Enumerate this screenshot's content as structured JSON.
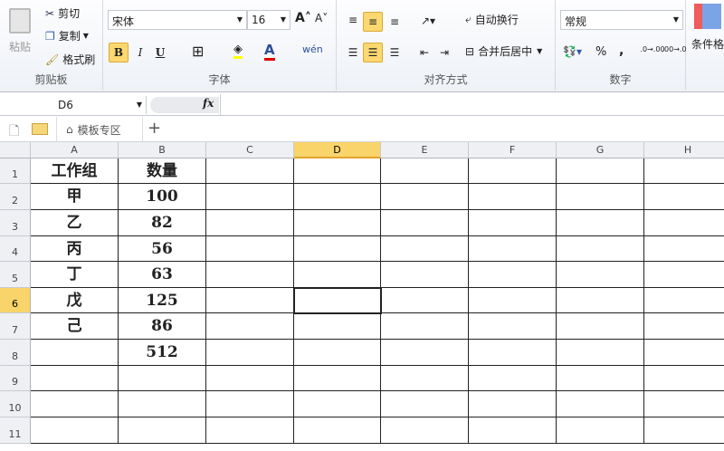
{
  "ribbon": {
    "clipboard": {
      "label": "剪贴板",
      "paste": "粘贴",
      "cut": "剪切",
      "copy": "复制",
      "format_painter": "格式刷"
    },
    "font": {
      "label": "字体",
      "font_name": "宋体",
      "font_size": "16",
      "bold": "B",
      "italic": "I",
      "underline": "U",
      "phonetic": "wén"
    },
    "alignment": {
      "label": "对齐方式",
      "wrap_text": "自动换行",
      "merge_center": "合并后居中"
    },
    "number": {
      "label": "数字",
      "format": "常规",
      "percent": "%",
      "comma": ",",
      "inc_decimal": ".0→.00",
      "dec_decimal": ".00→.0"
    },
    "styles": {
      "conditional_format": "条件格"
    }
  },
  "formula_bar": {
    "name_box": "D6",
    "fx": "fx",
    "value": ""
  },
  "tabs": {
    "template_zone": "模板专区",
    "add": "+"
  },
  "sheet": {
    "columns": [
      "A",
      "B",
      "C",
      "D",
      "E",
      "F",
      "G",
      "H"
    ],
    "rows": [
      "1",
      "2",
      "3",
      "4",
      "5",
      "6",
      "7",
      "8",
      "9",
      "10",
      "11"
    ],
    "selected_cell": "D6",
    "cells": [
      [
        "工作组",
        "数量"
      ],
      [
        "甲",
        "100"
      ],
      [
        "乙",
        "82"
      ],
      [
        "丙",
        "56"
      ],
      [
        "丁",
        "63"
      ],
      [
        "戊",
        "125"
      ],
      [
        "己",
        "86"
      ],
      [
        "",
        "512"
      ],
      [
        "",
        ""
      ],
      [
        "",
        ""
      ],
      [
        "",
        ""
      ]
    ]
  }
}
